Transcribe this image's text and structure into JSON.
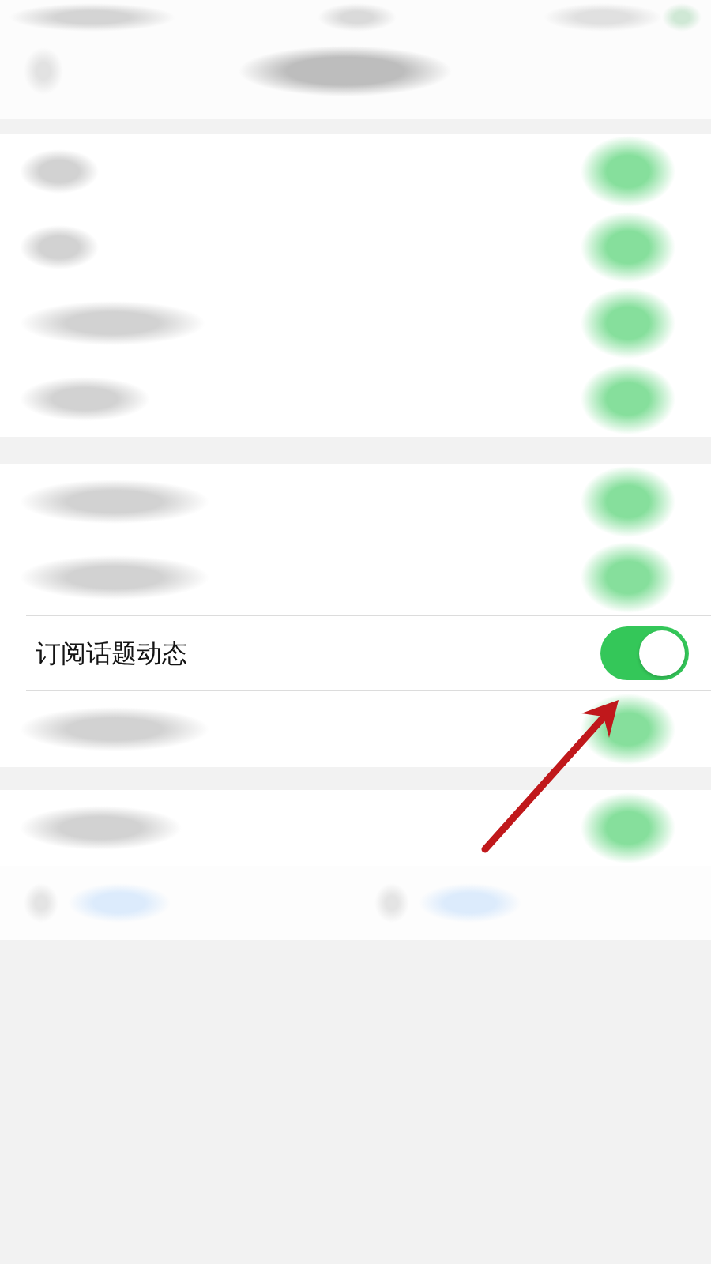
{
  "sections": [
    {
      "rows": [
        {
          "kind": "blurred",
          "on": true
        },
        {
          "kind": "blurred",
          "on": true
        },
        {
          "kind": "blurred",
          "on": true
        },
        {
          "kind": "blurred",
          "on": true
        }
      ]
    },
    {
      "rows": [
        {
          "kind": "blurred",
          "on": true
        },
        {
          "kind": "blurred",
          "on": true
        },
        {
          "kind": "setting",
          "label": "订阅话题动态",
          "on": true
        },
        {
          "kind": "blurred",
          "on": true
        }
      ]
    },
    {
      "rows": [
        {
          "kind": "blurred",
          "on": true
        }
      ]
    }
  ]
}
